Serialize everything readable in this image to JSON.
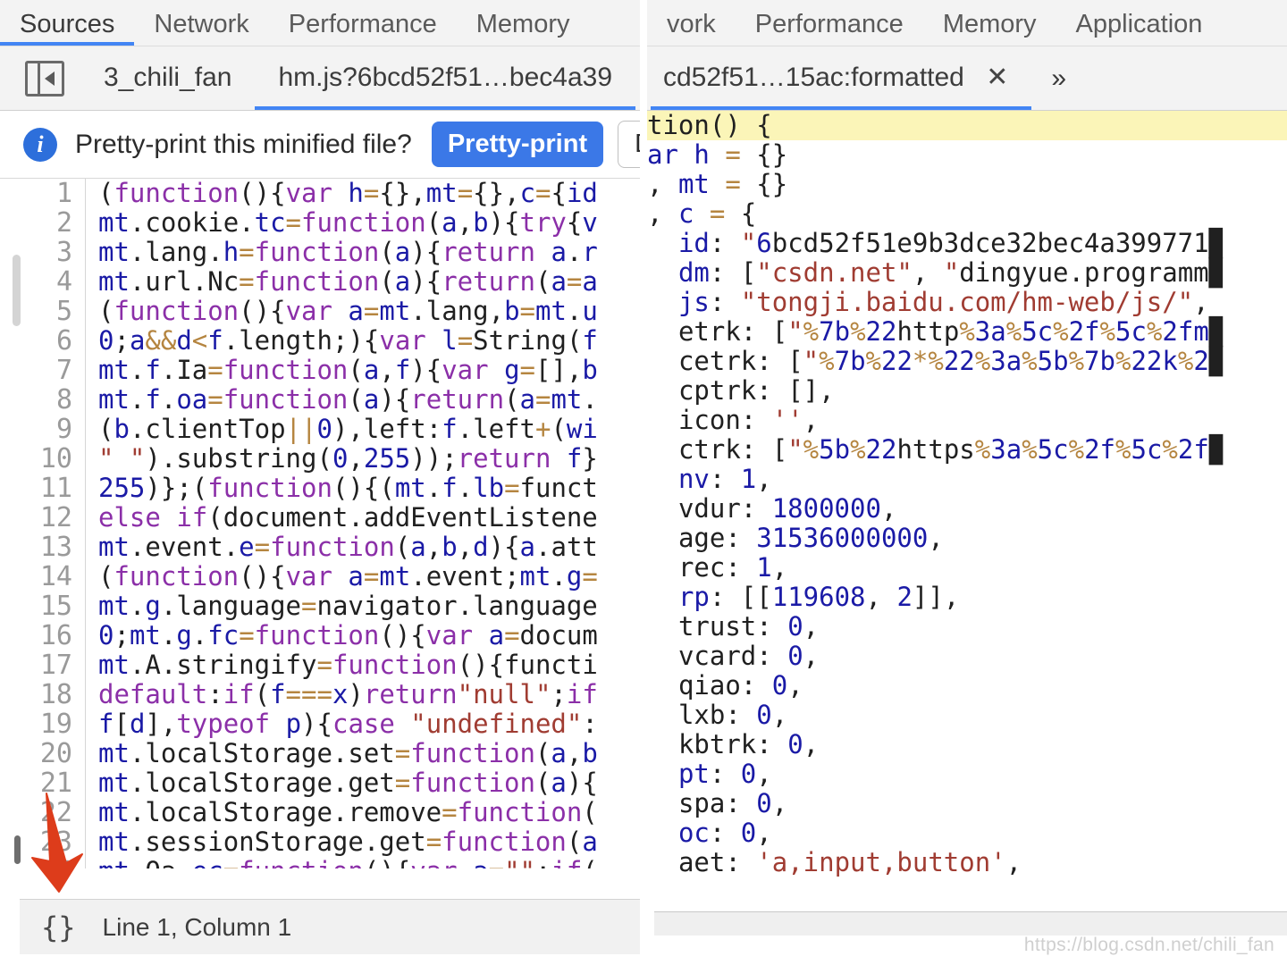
{
  "left_panel": {
    "devtools_tabs": [
      {
        "label": "Sources",
        "active": true
      },
      {
        "label": "Network",
        "active": false
      },
      {
        "label": "Performance",
        "active": false
      },
      {
        "label": "Memory",
        "active": false
      }
    ],
    "panel_toggle_icon": "collapse-sidebar-icon",
    "file_tabs": [
      {
        "label": "3_chili_fan",
        "active": false
      },
      {
        "label": "hm.js?6bcd52f51…bec4a39",
        "active": true
      }
    ],
    "infobar": {
      "icon": "info-icon",
      "message": "Pretty-print this minified file?",
      "primary_button": "Pretty-print",
      "secondary_button": "D"
    },
    "code_lines": [
      {
        "num": "1",
        "text": "(function(){var h={},mt={},c={id"
      },
      {
        "num": "2",
        "text": "mt.cookie.tc=function(a,b){try{v"
      },
      {
        "num": "3",
        "text": "mt.lang.h=function(a){return a.r"
      },
      {
        "num": "4",
        "text": "mt.url.Nc=function(a){return(a=a"
      },
      {
        "num": "5",
        "text": "(function(){var a=mt.lang,b=mt.u"
      },
      {
        "num": "6",
        "text": "0;a&&d<f.length;){var l=String(f"
      },
      {
        "num": "7",
        "text": "mt.f.Ia=function(a,f){var g=[],b"
      },
      {
        "num": "8",
        "text": "mt.f.oa=function(a){return(a=mt."
      },
      {
        "num": "9",
        "text": "(b.clientTop||0),left:f.left+(wi"
      },
      {
        "num": "10",
        "text": "\" \").substring(0,255));return f}"
      },
      {
        "num": "11",
        "text": "255)};(function(){(mt.f.lb=funct"
      },
      {
        "num": "12",
        "text": "else if(document.addEventListene"
      },
      {
        "num": "13",
        "text": "mt.event.e=function(a,b,d){a.att"
      },
      {
        "num": "14",
        "text": "(function(){var a=mt.event;mt.g="
      },
      {
        "num": "15",
        "text": "mt.g.language=navigator.language"
      },
      {
        "num": "16",
        "text": "0;mt.g.fc=function(){var a=docum"
      },
      {
        "num": "17",
        "text": "mt.A.stringify=function(){functi"
      },
      {
        "num": "18",
        "text": "default:if(f===x)return\"null\";if"
      },
      {
        "num": "19",
        "text": "f[d],typeof p){case \"undefined\":"
      },
      {
        "num": "20",
        "text": "mt.localStorage.set=function(a,b"
      },
      {
        "num": "21",
        "text": "mt.localStorage.get=function(a){"
      },
      {
        "num": "22",
        "text": "mt.localStorage.remove=function("
      },
      {
        "num": "23",
        "text": "mt.sessionStorage.get=function(a"
      },
      {
        "num": "24",
        "text": "mt.Qa.ec=function(){var a=\"\";if("
      }
    ],
    "statusbar": {
      "braces_icon": "{}",
      "text": "Line 1, Column 1"
    },
    "annotation": {
      "arrow": "red-down-arrow",
      "color": "#dd3c1b"
    }
  },
  "right_panel": {
    "devtools_tabs": [
      {
        "label": "vork",
        "active": false
      },
      {
        "label": "Performance",
        "active": false
      },
      {
        "label": "Memory",
        "active": false
      },
      {
        "label": "Application",
        "active": false
      }
    ],
    "file_tabs": [
      {
        "label": "cd52f51…15ac:formatted",
        "active": true,
        "close_icon": "close-icon"
      }
    ],
    "more_tabs_icon": "»",
    "code_lines": [
      {
        "text": "tion() {",
        "highlight": true
      },
      {
        "text": "ar h = {}",
        "highlight": false
      },
      {
        "text": ", mt = {}",
        "highlight": false
      },
      {
        "text": ", c = {",
        "highlight": false
      },
      {
        "text": "  id: \"6bcd52f51e9b3dce32bec4a399771▉",
        "highlight": false
      },
      {
        "text": "  dm: [\"csdn.net\", \"dingyue.programm▉",
        "highlight": false
      },
      {
        "text": "  js: \"tongji.baidu.com/hm-web/js/\",",
        "highlight": false
      },
      {
        "text": "  etrk: [\"%7b%22http%3a%5c%2f%5c%2fm▉",
        "highlight": false
      },
      {
        "text": "  cetrk: [\"%7b%22*%22%3a%5b%7b%22k%2▉",
        "highlight": false
      },
      {
        "text": "  cptrk: [],",
        "highlight": false
      },
      {
        "text": "  icon: '',",
        "highlight": false
      },
      {
        "text": "  ctrk: [\"%5b%22https%3a%5c%2f%5c%2f▉",
        "highlight": false
      },
      {
        "text": "  nv: 1,",
        "highlight": false
      },
      {
        "text": "  vdur: 1800000,",
        "highlight": false
      },
      {
        "text": "  age: 31536000000,",
        "highlight": false
      },
      {
        "text": "  rec: 1,",
        "highlight": false
      },
      {
        "text": "  rp: [[119608, 2]],",
        "highlight": false
      },
      {
        "text": "  trust: 0,",
        "highlight": false
      },
      {
        "text": "  vcard: 0,",
        "highlight": false
      },
      {
        "text": "  qiao: 0,",
        "highlight": false
      },
      {
        "text": "  lxb: 0,",
        "highlight": false
      },
      {
        "text": "  kbtrk: 0,",
        "highlight": false
      },
      {
        "text": "  pt: 0,",
        "highlight": false
      },
      {
        "text": "  spa: 0,",
        "highlight": false
      },
      {
        "text": "  oc: 0,",
        "highlight": false
      },
      {
        "text": "  aet: 'a,input,button',",
        "highlight": false
      }
    ],
    "watermark": "https://blog.csdn.net/chili_fan"
  },
  "colors": {
    "accent_blue": "#4285f4",
    "button_blue": "#3b78e7",
    "keyword_purple": "#8b2fa8",
    "number_blue": "#1a1aa6",
    "string_red": "#a03c32",
    "operator_tan": "#b58540",
    "highlight_yellow": "#fbf5b8",
    "arrow_red": "#dd3c1b"
  }
}
